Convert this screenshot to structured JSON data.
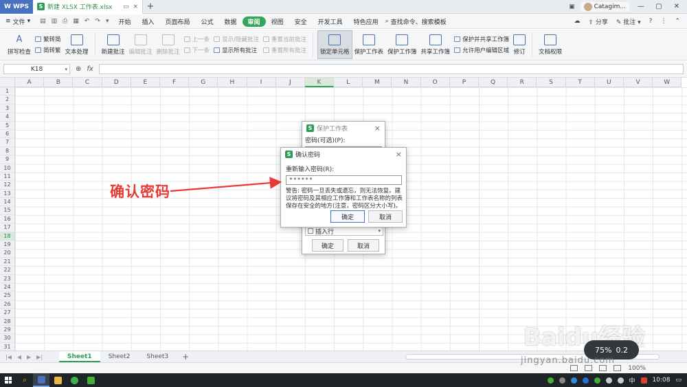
{
  "titlebar": {
    "app": "WPS",
    "doc_tab": "新建 XLSX 工作表.xlsx",
    "user": "Catagim..."
  },
  "menubar": {
    "file": "文件",
    "items": [
      "开始",
      "插入",
      "页面布局",
      "公式",
      "数据",
      "审阅",
      "视图",
      "安全",
      "开发工具",
      "特色应用"
    ],
    "active_item": "审阅",
    "search": "查找命令、搜索模板",
    "share": "分享",
    "comment": "批注"
  },
  "ribbon": {
    "spellcheck": "拼写检查",
    "trad_to_simp": "繁转简",
    "simp_to_trad": "简转繁",
    "text_process": "文本处理",
    "new_comment": "新建批注",
    "edit_comment": "编辑批注",
    "delete_comment": "删除批注",
    "prev": "上一条",
    "next": "下一条",
    "show_hide_comment": "显示/隐藏批注",
    "show_all_comments": "显示所有批注",
    "reset_current_comment": "重置当前批注",
    "reset_all_comments": "重置所有批注",
    "lock_cell": "锁定单元格",
    "protect_sheet": "保护工作表",
    "protect_workbook": "保护工作簿",
    "share_workbook": "共享工作簿",
    "protect_share_workbook": "保护并共享工作簿",
    "allow_edit_ranges": "允许用户编辑区域",
    "revise": "修订",
    "doc_permission": "文档权限"
  },
  "formula": {
    "cell_ref": "K18",
    "fx": "fx",
    "value": ""
  },
  "grid": {
    "columns": [
      "A",
      "B",
      "C",
      "D",
      "E",
      "F",
      "G",
      "H",
      "I",
      "J",
      "K",
      "L",
      "M",
      "N",
      "O",
      "P",
      "Q",
      "R",
      "S",
      "T",
      "U",
      "V",
      "W"
    ],
    "selected_column": "K",
    "rows": [
      "1",
      "2",
      "3",
      "4",
      "5",
      "6",
      "7",
      "8",
      "9",
      "10",
      "11",
      "12",
      "13",
      "14",
      "15",
      "16",
      "17",
      "18",
      "19",
      "20",
      "21",
      "22",
      "23",
      "24",
      "25",
      "26",
      "27",
      "28",
      "29",
      "30",
      "31"
    ],
    "selected_row": "18"
  },
  "sheets": {
    "tabs": [
      "Sheet1",
      "Sheet2",
      "Sheet3"
    ],
    "active": "Sheet1",
    "add": "+"
  },
  "status": {
    "zoom": "100%"
  },
  "taskbar": {
    "time": "10:08",
    "lang": "中"
  },
  "protect_dialog": {
    "title": "保护工作表",
    "password_label": "密码(可选)(P):",
    "password_value": "******",
    "option_insert_rows": "插入行",
    "ok": "确定",
    "cancel": "取消"
  },
  "confirm_dialog": {
    "title": "确认密码",
    "reenter_label": "重新输入密码(R):",
    "password_value": "******",
    "warning": "警告: 密码一旦丢失或遗忘，则无法恢复。建议将密码及其相应工作簿和工作表名称的列表保存在安全的地方(注意，密码区分大小写)。",
    "ok": "确定",
    "cancel": "取消"
  },
  "annotation": {
    "text": "确认密码",
    "color": "#e83a35"
  },
  "watermark": {
    "brand": "Baidu经验",
    "url": "jingyan.baidu.com",
    "badge_left": "75%",
    "badge_right": "0.2"
  },
  "colors": {
    "accent_green": "#33a85a",
    "wps_blue": "#4a70c0"
  }
}
